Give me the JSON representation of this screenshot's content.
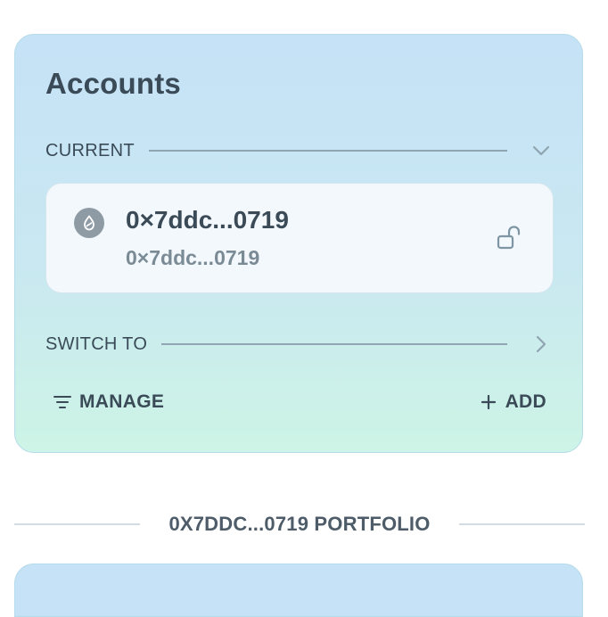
{
  "accounts": {
    "title": "Accounts",
    "current_label": "CURRENT",
    "switch_label": "SWITCH TO",
    "current_account": {
      "name": "0×7ddc...0719",
      "address": "0×7ddc...0719",
      "icon": "sui-drop-icon",
      "lock_icon": "unlocked-padlock-icon"
    },
    "manage_label": "MANAGE",
    "add_label": "ADD"
  },
  "portfolio": {
    "label": "0X7DDC...0719 PORTFOLIO"
  },
  "colors": {
    "card_gradient_top": "#c5e2f6",
    "card_gradient_bottom": "#cdf4e6",
    "text_primary": "#3a4a57",
    "text_secondary": "#7a8b96"
  }
}
